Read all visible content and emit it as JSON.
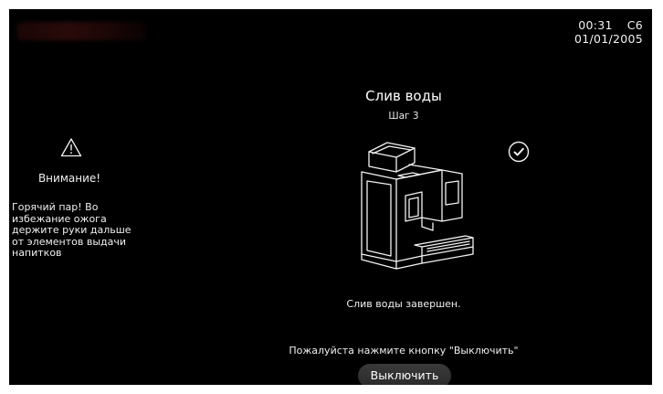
{
  "status_bar": {
    "time": "00:31",
    "code": "C6",
    "date": "01/01/2005"
  },
  "warning": {
    "icon": "warning-triangle-icon",
    "title": "Внимание!",
    "text": "Горячий пар! Во избежание ожога держите руки дальше от элементов выдачи напитков"
  },
  "main": {
    "title": "Слив воды",
    "step": "Шаг 3",
    "illustration_icon": "coffee-machine-icon",
    "check_icon": "check-circle-icon",
    "status": "Слив воды завершен.",
    "instruction": "Пожалуйста нажмите кнопку \"Выключить\"",
    "button_label": "Выключить"
  },
  "colors": {
    "background": "#000000",
    "text": "#ffffff",
    "button": "#333333"
  }
}
